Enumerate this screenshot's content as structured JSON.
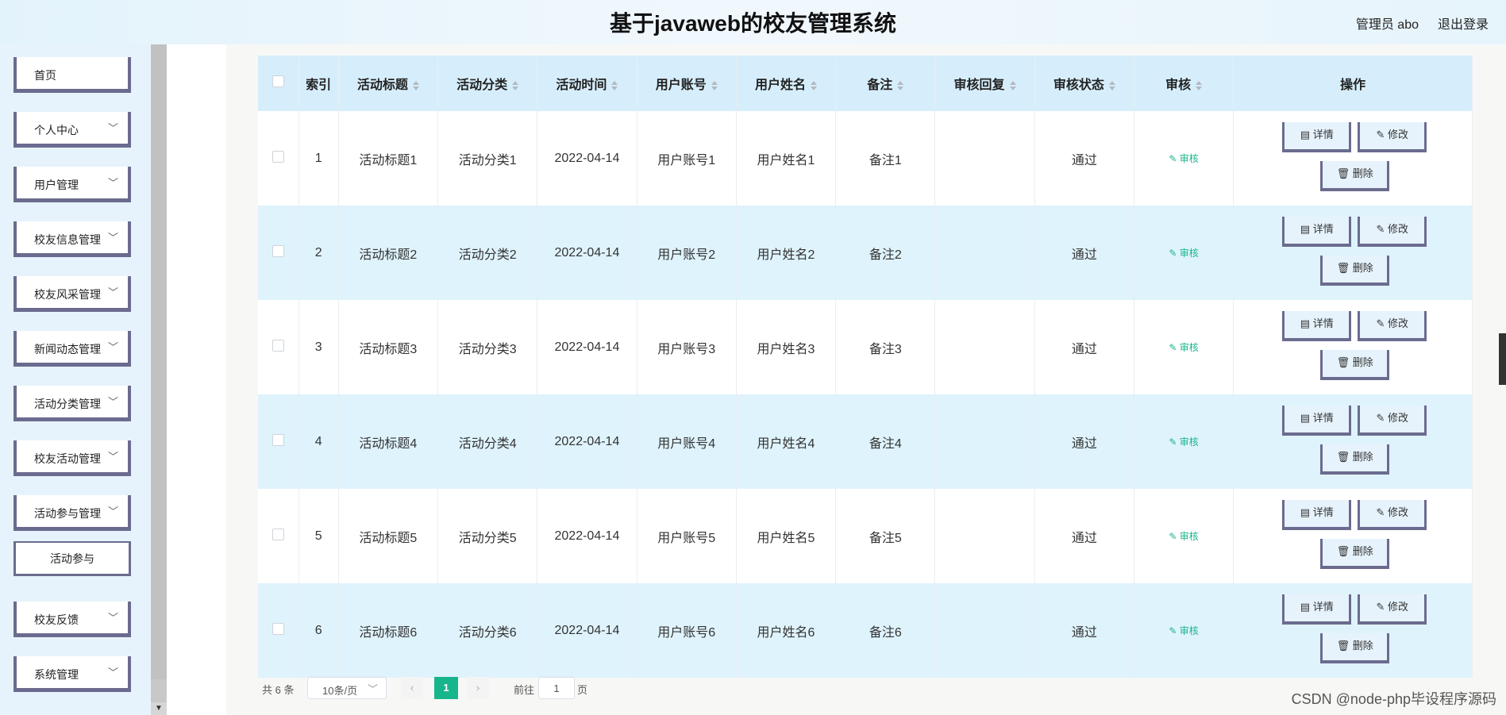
{
  "header": {
    "title": "基于javaweb的校友管理系统",
    "user": "管理员 abo",
    "logout": "退出登录"
  },
  "sidebar": {
    "items": [
      {
        "label": "首页",
        "has_chevron": false
      },
      {
        "label": "个人中心",
        "has_chevron": true
      },
      {
        "label": "用户管理",
        "has_chevron": true
      },
      {
        "label": "校友信息管理",
        "has_chevron": true
      },
      {
        "label": "校友风采管理",
        "has_chevron": true
      },
      {
        "label": "新闻动态管理",
        "has_chevron": true
      },
      {
        "label": "活动分类管理",
        "has_chevron": true
      },
      {
        "label": "校友活动管理",
        "has_chevron": true
      },
      {
        "label": "活动参与管理",
        "has_chevron": true
      },
      {
        "label": "活动参与",
        "sub": true
      },
      {
        "label": "校友反馈",
        "has_chevron": true
      },
      {
        "label": "系统管理",
        "has_chevron": true
      }
    ]
  },
  "table": {
    "headers": [
      "索引",
      "活动标题",
      "活动分类",
      "活动时间",
      "用户账号",
      "用户姓名",
      "备注",
      "审核回复",
      "审核状态",
      "审核",
      "操作"
    ],
    "rows": [
      {
        "idx": "1",
        "title": "活动标题1",
        "category": "活动分类1",
        "time": "2022-04-14",
        "account": "用户账号1",
        "name": "用户姓名1",
        "note": "备注1",
        "reply": "",
        "status": "通过"
      },
      {
        "idx": "2",
        "title": "活动标题2",
        "category": "活动分类2",
        "time": "2022-04-14",
        "account": "用户账号2",
        "name": "用户姓名2",
        "note": "备注2",
        "reply": "",
        "status": "通过"
      },
      {
        "idx": "3",
        "title": "活动标题3",
        "category": "活动分类3",
        "time": "2022-04-14",
        "account": "用户账号3",
        "name": "用户姓名3",
        "note": "备注3",
        "reply": "",
        "status": "通过"
      },
      {
        "idx": "4",
        "title": "活动标题4",
        "category": "活动分类4",
        "time": "2022-04-14",
        "account": "用户账号4",
        "name": "用户姓名4",
        "note": "备注4",
        "reply": "",
        "status": "通过"
      },
      {
        "idx": "5",
        "title": "活动标题5",
        "category": "活动分类5",
        "time": "2022-04-14",
        "account": "用户账号5",
        "name": "用户姓名5",
        "note": "备注5",
        "reply": "",
        "status": "通过"
      },
      {
        "idx": "6",
        "title": "活动标题6",
        "category": "活动分类6",
        "time": "2022-04-14",
        "account": "用户账号6",
        "name": "用户姓名6",
        "note": "备注6",
        "reply": "",
        "status": "通过"
      }
    ],
    "audit_label": "审核",
    "detail_label": "详情",
    "edit_label": "修改",
    "delete_label": "删除"
  },
  "pagination": {
    "total": "共 6 条",
    "page_size": "10条/页",
    "current_page": "1",
    "goto_label": "前往",
    "goto_value": "1",
    "page_word": "页"
  },
  "watermark": "CSDN @node-php毕设程序源码",
  "colors": {
    "accent": "#17b58c",
    "header_row": "#d6eefb",
    "stripe": "#dff3fc",
    "button_border": "#6b6b8f"
  }
}
